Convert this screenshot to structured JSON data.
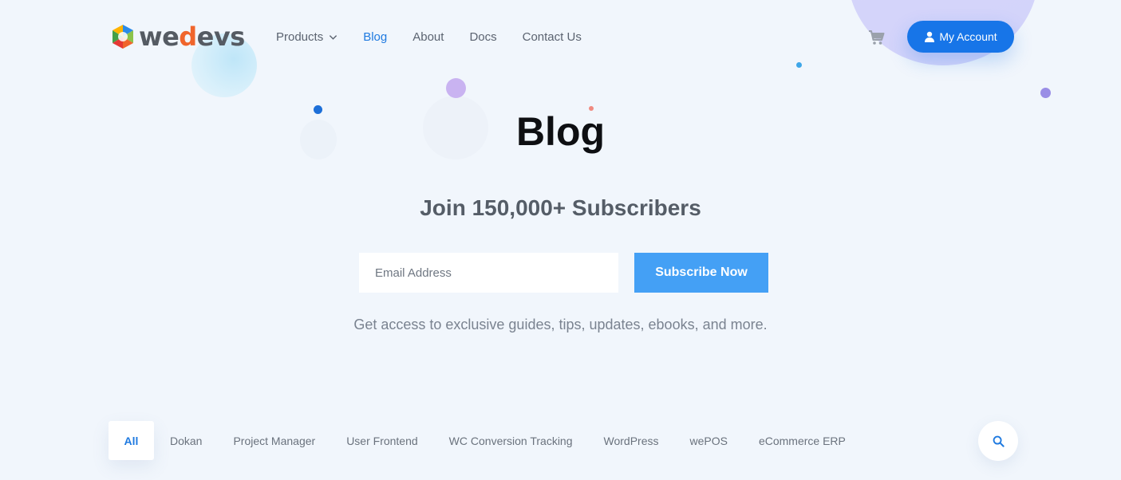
{
  "brand": {
    "name_prefix": "we",
    "name_accent": "d",
    "name_suffix": "evs"
  },
  "nav": {
    "items": [
      {
        "label": "Products",
        "has_dropdown": true,
        "active": false
      },
      {
        "label": "Blog",
        "active": true
      },
      {
        "label": "About",
        "active": false
      },
      {
        "label": "Docs",
        "active": false
      },
      {
        "label": "Contact Us",
        "active": false
      }
    ]
  },
  "header": {
    "cart_icon": "cart-icon",
    "account_label": "My Account",
    "account_icon": "user-icon"
  },
  "hero": {
    "title": "Blog",
    "subtitle": "Join 150,000+ Subscribers",
    "email_placeholder": "Email Address",
    "subscribe_label": "Subscribe Now",
    "note": "Get access to exclusive guides, tips, updates, ebooks, and more."
  },
  "categories": {
    "items": [
      "All",
      "Dokan",
      "Project Manager",
      "User Frontend",
      "WC Conversion Tracking",
      "WordPress",
      "wePOS",
      "eCommerce ERP"
    ],
    "selected": "All",
    "search_icon": "search-icon"
  },
  "colors": {
    "accent": "#1f7ae0",
    "account_button": "#1775e8",
    "subscribe_button": "#44a0f5",
    "background": "#f1f6fc"
  }
}
